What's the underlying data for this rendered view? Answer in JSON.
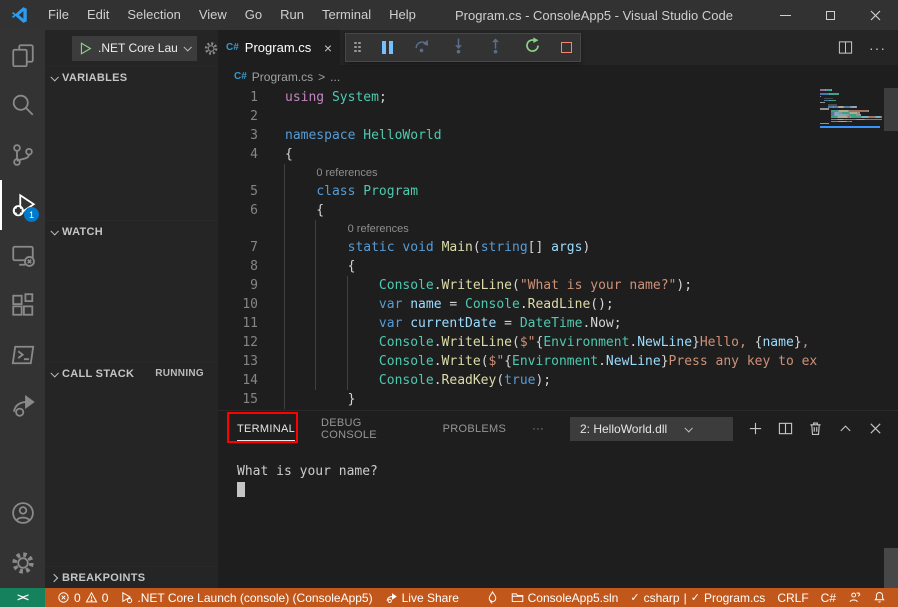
{
  "title_bar": {
    "menus": [
      "File",
      "Edit",
      "Selection",
      "View",
      "Go",
      "Run",
      "Terminal",
      "Help"
    ],
    "title": "Program.cs - ConsoleApp5 - Visual Studio Code"
  },
  "activity_bar": {
    "debug_badge": "1"
  },
  "sidebar": {
    "launch_label": ".NET Core Lau",
    "variables_label": "VARIABLES",
    "watch_label": "WATCH",
    "call_stack_label": "CALL STACK",
    "call_stack_status": "RUNNING",
    "breakpoints_label": "BREAKPOINTS"
  },
  "editor": {
    "tab_label": "Program.cs",
    "tab_close": "×",
    "file_icon": "C#",
    "breadcrumb_file": "Program.cs",
    "breadcrumb_sep": ">",
    "breadcrumb_more": "...",
    "actions_more": "···",
    "codelens_text": "0 references",
    "lines": [
      {
        "n": "1",
        "t": [
          [
            "u",
            "using"
          ],
          [
            "p",
            " "
          ],
          [
            "t",
            "System"
          ],
          [
            "p",
            ";"
          ]
        ]
      },
      {
        "n": "2",
        "t": []
      },
      {
        "n": "3",
        "t": [
          [
            "k",
            "namespace"
          ],
          [
            "p",
            " "
          ],
          [
            "t",
            "HelloWorld"
          ]
        ]
      },
      {
        "n": "4",
        "t": [
          [
            "p",
            "{"
          ]
        ]
      },
      {
        "n": "5",
        "lens": 4,
        "t": [
          [
            "p",
            "    "
          ],
          [
            "k",
            "class"
          ],
          [
            "p",
            " "
          ],
          [
            "t",
            "Program"
          ]
        ]
      },
      {
        "n": "6",
        "t": [
          [
            "p",
            "    {"
          ]
        ]
      },
      {
        "n": "7",
        "lens": 8,
        "t": [
          [
            "p",
            "        "
          ],
          [
            "k",
            "static"
          ],
          [
            "p",
            " "
          ],
          [
            "k",
            "void"
          ],
          [
            "p",
            " "
          ],
          [
            "m",
            "Main"
          ],
          [
            "p",
            "("
          ],
          [
            "k",
            "string"
          ],
          [
            "p",
            "[] "
          ],
          [
            "v",
            "args"
          ],
          [
            "p",
            ")"
          ]
        ]
      },
      {
        "n": "8",
        "t": [
          [
            "p",
            "        {"
          ]
        ]
      },
      {
        "n": "9",
        "t": [
          [
            "p",
            "            "
          ],
          [
            "t",
            "Console"
          ],
          [
            "p",
            "."
          ],
          [
            "m",
            "WriteLine"
          ],
          [
            "p",
            "("
          ],
          [
            "s",
            "\"What is your name?\""
          ],
          [
            "p",
            ");"
          ]
        ]
      },
      {
        "n": "10",
        "t": [
          [
            "p",
            "            "
          ],
          [
            "k",
            "var"
          ],
          [
            "p",
            " "
          ],
          [
            "v",
            "name"
          ],
          [
            "p",
            " = "
          ],
          [
            "t",
            "Console"
          ],
          [
            "p",
            "."
          ],
          [
            "m",
            "ReadLine"
          ],
          [
            "p",
            "();"
          ]
        ]
      },
      {
        "n": "11",
        "t": [
          [
            "p",
            "            "
          ],
          [
            "k",
            "var"
          ],
          [
            "p",
            " "
          ],
          [
            "v",
            "currentDate"
          ],
          [
            "p",
            " = "
          ],
          [
            "t",
            "DateTime"
          ],
          [
            "p",
            ".Now;"
          ]
        ]
      },
      {
        "n": "12",
        "bp": true,
        "t": [
          [
            "p",
            "            "
          ],
          [
            "t",
            "Console"
          ],
          [
            "p",
            "."
          ],
          [
            "m",
            "WriteLine"
          ],
          [
            "p",
            "("
          ],
          [
            "s",
            "$\""
          ],
          [
            "p",
            "{"
          ],
          [
            "t",
            "Environment"
          ],
          [
            "p",
            "."
          ],
          [
            "v",
            "NewLine"
          ],
          [
            "p",
            "}"
          ],
          [
            "s",
            "Hello, "
          ],
          [
            "p",
            "{"
          ],
          [
            "v",
            "name"
          ],
          [
            "p",
            "}"
          ],
          [
            "s",
            ","
          ]
        ]
      },
      {
        "n": "13",
        "t": [
          [
            "p",
            "            "
          ],
          [
            "t",
            "Console"
          ],
          [
            "p",
            "."
          ],
          [
            "m",
            "Write"
          ],
          [
            "p",
            "("
          ],
          [
            "s",
            "$\""
          ],
          [
            "p",
            "{"
          ],
          [
            "t",
            "Environment"
          ],
          [
            "p",
            "."
          ],
          [
            "v",
            "NewLine"
          ],
          [
            "p",
            "}"
          ],
          [
            "s",
            "Press any key to ex"
          ]
        ]
      },
      {
        "n": "14",
        "t": [
          [
            "p",
            "            "
          ],
          [
            "t",
            "Console"
          ],
          [
            "p",
            "."
          ],
          [
            "m",
            "ReadKey"
          ],
          [
            "p",
            "("
          ],
          [
            "k",
            "true"
          ],
          [
            "p",
            ");"
          ]
        ]
      },
      {
        "n": "15",
        "t": [
          [
            "p",
            "        }"
          ]
        ]
      }
    ]
  },
  "panel": {
    "tabs": [
      "TERMINAL",
      "DEBUG CONSOLE",
      "PROBLEMS"
    ],
    "more": "···",
    "dropdown_value": "2: HelloWorld.dll",
    "output_line": "What is your name?"
  },
  "status_bar": {
    "errors": "0",
    "warnings": "0",
    "debug_target": ".NET Core Launch (console) (ConsoleApp5)",
    "live_share": "Live Share",
    "solution": "ConsoleApp5.sln",
    "lang_check": "✓",
    "lang_status": "csharp",
    "separator": "|",
    "file_check": "✓",
    "file_status": "Program.cs",
    "eol": "CRLF",
    "language": "C#"
  }
}
